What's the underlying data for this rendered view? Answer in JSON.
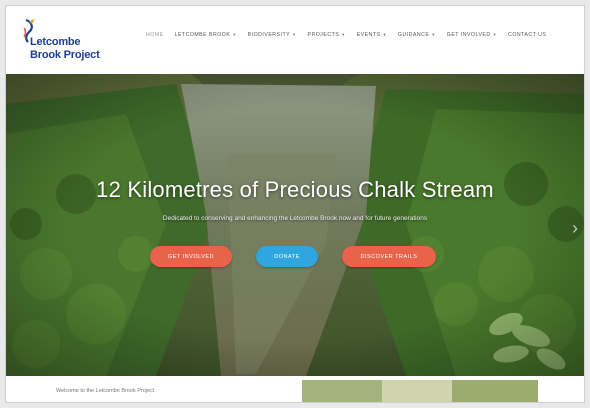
{
  "logo": {
    "line1": "Letcombe",
    "line2": "Brook Project"
  },
  "nav": {
    "items": [
      {
        "label": "Home",
        "active": true,
        "dropdown": false
      },
      {
        "label": "Letcombe Brook",
        "active": false,
        "dropdown": true
      },
      {
        "label": "Biodiversity",
        "active": false,
        "dropdown": true
      },
      {
        "label": "Projects",
        "active": false,
        "dropdown": true
      },
      {
        "label": "Events",
        "active": false,
        "dropdown": true
      },
      {
        "label": "Guidance",
        "active": false,
        "dropdown": true
      },
      {
        "label": "Get Involved",
        "active": false,
        "dropdown": true
      },
      {
        "label": "Contact Us",
        "active": false,
        "dropdown": false
      }
    ]
  },
  "hero": {
    "title": "12 Kilometres of Precious Chalk Stream",
    "subtitle": "Dedicated to conserving and enhancing the Letcombe Brook now and for future generations",
    "buttons": [
      {
        "label": "Get Involved",
        "color": "#e8634a"
      },
      {
        "label": "Donate",
        "color": "#2fa6de"
      },
      {
        "label": "Discover Trails",
        "color": "#e8634a"
      }
    ],
    "next_arrow": "›"
  },
  "below": {
    "text": "Welcome to the Letcombe Brook Project"
  },
  "colors": {
    "brand_blue": "#1f3f8f",
    "accent_orange": "#e8634a",
    "accent_blue": "#2fa6de"
  }
}
